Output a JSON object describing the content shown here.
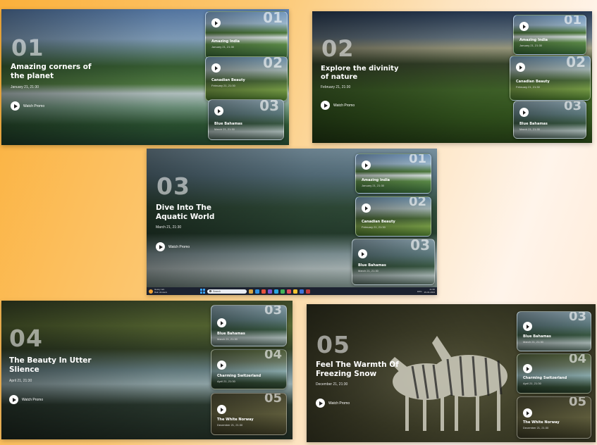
{
  "slides": [
    {
      "number": "01",
      "title_line1": "Amazing corners of",
      "title_line2": "the planet",
      "date": "January 21, 21:30",
      "watch_label": "Watch Promo",
      "cards": [
        {
          "number": "01",
          "title": "Amazing India",
          "date": "January 21, 21:30",
          "bg": "fall"
        },
        {
          "number": "02",
          "title": "Canadian Beauty",
          "date": "February 21, 21:30",
          "bg": "canada"
        },
        {
          "number": "03",
          "title": "Blue Bahamas",
          "date": "March 21, 21:30",
          "bg": "bahamas"
        }
      ]
    },
    {
      "number": "02",
      "title_line1": "Explore the divinity",
      "title_line2": "of nature",
      "date": "February 21, 21:30",
      "watch_label": "Watch Promo",
      "cards": [
        {
          "number": "01",
          "title": "Amazing India",
          "date": "January 21, 21:30",
          "bg": "fall"
        },
        {
          "number": "02",
          "title": "Canadian Beauty",
          "date": "February 21, 21:30",
          "bg": "canada"
        },
        {
          "number": "03",
          "title": "Blue Bahamas",
          "date": "March 21, 21:30",
          "bg": "bahamas"
        }
      ]
    },
    {
      "number": "03",
      "title_line1": "Dive Into The",
      "title_line2": "Aquatic World",
      "date": "March 21, 21:30",
      "watch_label": "Watch Promo",
      "cards": [
        {
          "number": "01",
          "title": "Amazing India",
          "date": "January 21, 21:30",
          "bg": "fall"
        },
        {
          "number": "02",
          "title": "Canadian Beauty",
          "date": "February 21, 21:30",
          "bg": "canada"
        },
        {
          "number": "03",
          "title": "Blue Bahamas",
          "date": "March 21, 21:30",
          "bg": "bahamas"
        }
      ]
    },
    {
      "number": "04",
      "title_line1": "The Beauty In Utter",
      "title_line2": "Slience",
      "date": "April 21, 21:30",
      "watch_label": "Watch Promo",
      "cards": [
        {
          "number": "03",
          "title": "Blue Bahamas",
          "date": "March 21, 21:30",
          "bg": "bahamas"
        },
        {
          "number": "04",
          "title": "Charming Switzerland",
          "date": "April 21, 21:30",
          "bg": "swiss"
        },
        {
          "number": "05",
          "title": "The White Norway",
          "date": "December 21, 21:30",
          "bg": "norway"
        }
      ]
    },
    {
      "number": "05",
      "title_line1": "Feel The Warmth Of",
      "title_line2": "Freezing Snow",
      "date": "December 21, 21:30",
      "watch_label": "Watch Promo",
      "cards": [
        {
          "number": "03",
          "title": "Blue Bahamas",
          "date": "March 21, 21:30",
          "bg": "bahamas"
        },
        {
          "number": "04",
          "title": "Charming Switzerland",
          "date": "April 21, 21:30",
          "bg": "swiss"
        },
        {
          "number": "05",
          "title": "The White Norway",
          "date": "December 21, 21:30",
          "bg": "norway"
        }
      ]
    }
  ],
  "taskbar": {
    "weather_line1": "Heavy rain",
    "weather_line2": "Rain showers",
    "search_placeholder": "Search",
    "time": "21:30",
    "date": "29-04-2024",
    "lang": "ENG"
  },
  "colors": {
    "background_start": "#fbb03b",
    "background_end": "#fff4ea",
    "text": "#ffffff"
  }
}
